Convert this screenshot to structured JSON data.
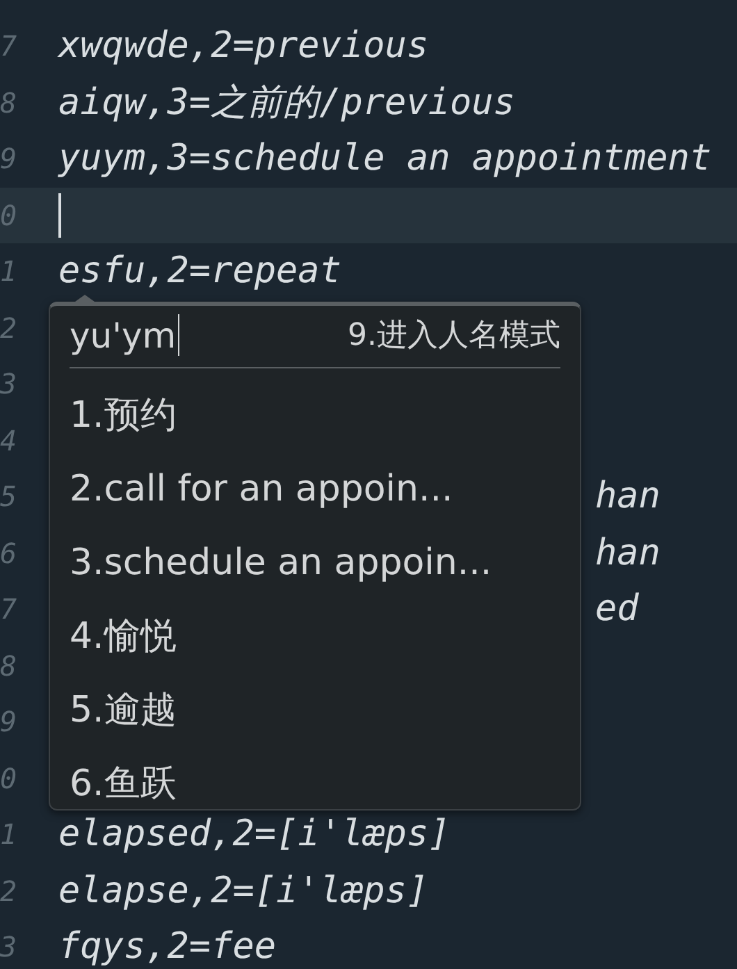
{
  "editor": {
    "lines": [
      {
        "number": "7",
        "kind": "code",
        "text": "xwqwde,2=previous"
      },
      {
        "number": "8",
        "kind": "code",
        "text": "aiqw,3=之前的/previous"
      },
      {
        "number": "9",
        "kind": "code",
        "text": "yuym,3=schedule an appointment"
      },
      {
        "number": "0",
        "kind": "cursor"
      },
      {
        "number": "1",
        "kind": "code",
        "text": "esfu,2=repeat"
      },
      {
        "number": "2",
        "kind": "covered"
      },
      {
        "number": "3",
        "kind": "covered"
      },
      {
        "number": "4",
        "kind": "covered"
      },
      {
        "number": "5",
        "kind": "tail",
        "text": "han"
      },
      {
        "number": "6",
        "kind": "tail",
        "text": "han"
      },
      {
        "number": "7",
        "kind": "tail",
        "text": "ed"
      },
      {
        "number": "8",
        "kind": "covered"
      },
      {
        "number": "9",
        "kind": "covered"
      },
      {
        "number": "0",
        "kind": "covered"
      },
      {
        "number": "1",
        "kind": "code",
        "text": "elapsed,2=[i'læps]"
      },
      {
        "number": "2",
        "kind": "code",
        "text": "elapse,2=[i'læps]"
      },
      {
        "number": "3",
        "kind": "code",
        "text": "fqys,2=fee"
      }
    ]
  },
  "ime": {
    "composition": "yu'ym",
    "hint": "9.进入人名模式",
    "candidates": [
      "1.预约",
      "2.call for an appoin...",
      "3.schedule an appoin...",
      "4.愉悦",
      "5.逾越",
      "6.鱼跃"
    ]
  }
}
